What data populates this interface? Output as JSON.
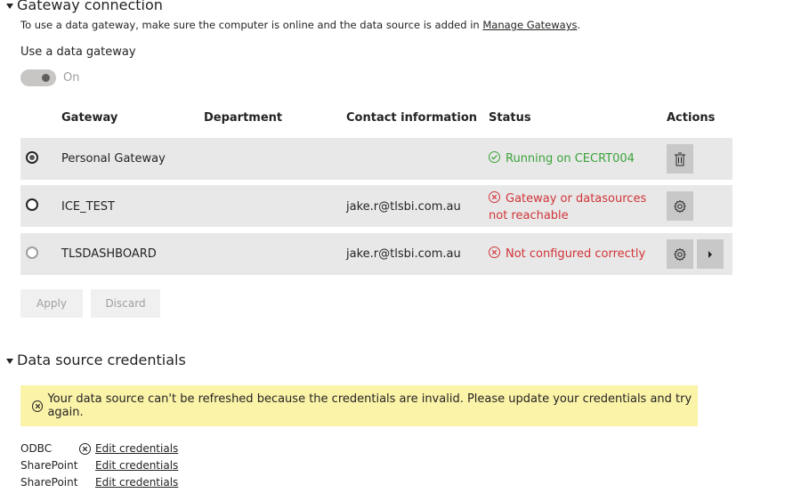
{
  "gateway_section": {
    "title": "Gateway connection",
    "description": "To use a data gateway, make sure the computer is online and the data source is added in",
    "manage_link": "Manage Gateways",
    "period": ".",
    "use_gateway_label": "Use a data gateway",
    "toggle_label": "On"
  },
  "table": {
    "headers": {
      "gateway": "Gateway",
      "department": "Department",
      "contact": "Contact information",
      "status": "Status",
      "actions": "Actions"
    },
    "rows": [
      {
        "gateway": "Personal Gateway",
        "department": "",
        "contact": "",
        "status_line1": "Running on CECRT004",
        "status_line2": ""
      },
      {
        "gateway": "ICE_TEST",
        "department": "",
        "contact": "jake.r@tlsbi.com.au",
        "status_line1": "Gateway or datasources",
        "status_line2": "not reachable"
      },
      {
        "gateway": "TLSDASHBOARD",
        "department": "",
        "contact": "jake.r@tlsbi.com.au",
        "status_line1": "Not configured correctly",
        "status_line2": ""
      }
    ]
  },
  "buttons": {
    "apply": "Apply",
    "discard": "Discard"
  },
  "credentials_section": {
    "title": "Data source credentials",
    "warning": "Your data source can't be refreshed because the credentials are invalid. Please update your credentials and try again.",
    "items": [
      {
        "type": "ODBC",
        "link": "Edit credentials"
      },
      {
        "type": "SharePoint",
        "link": "Edit credentials"
      },
      {
        "type": "SharePoint",
        "link": "Edit credentials"
      }
    ]
  },
  "colors": {
    "ok": "#3ba33b",
    "error": "#d13438",
    "warning_bg": "#fbf3a8",
    "row_bg": "#e8e8e8"
  }
}
